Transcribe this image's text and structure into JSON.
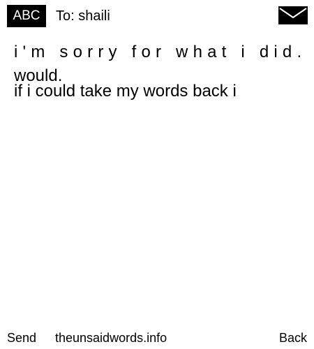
{
  "header": {
    "input_mode": "ABC",
    "to_label": "To: shaili",
    "icon": "envelope-icon"
  },
  "message": {
    "line1": "i'm sorry for what i did.",
    "line1_wrap": "would.",
    "line2": "if i could take my words back i"
  },
  "footer": {
    "send_label": "Send",
    "site_label": "theunsaidwords.info",
    "back_label": "Back"
  },
  "colors": {
    "background": "#ffffff",
    "foreground": "#000000",
    "badge_text": "#ffffff"
  }
}
